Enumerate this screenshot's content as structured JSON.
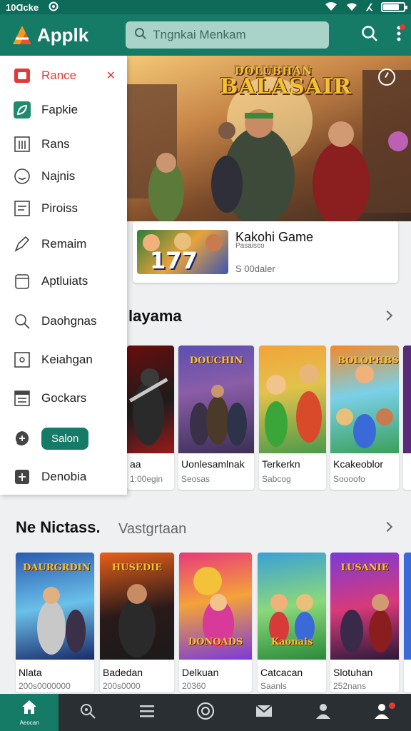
{
  "status_bar": {
    "left_text": "10Ɑcke",
    "battery_level": 0.8
  },
  "app": {
    "name": "Applk",
    "search_placeholder": "Tngnkai Menkam",
    "brand_color": "#157a66"
  },
  "hero": {
    "title_line1": "DOLUBHAN",
    "title_line2": "BALASAIR"
  },
  "featured": {
    "thumb_number": "177",
    "name": "Kakohi Game",
    "subtitle": "Pasaisco",
    "meta": "S 00daler"
  },
  "section1": {
    "title": "layama"
  },
  "row1_cards": [
    {
      "name": "aa",
      "meta": "1:00egin",
      "tag": ""
    },
    {
      "name": "Uonlesamlnak",
      "meta": "Seosas",
      "tag": "DOUCHIN"
    },
    {
      "name": "Terkerkn",
      "meta": "Sabcog",
      "tag": ""
    },
    {
      "name": "Kcakeoblor",
      "meta": "Soooofo",
      "tag": "BOLOPHBS"
    }
  ],
  "section2": {
    "title": "Ne Nictass.",
    "subtitle": "Vastgrtaan"
  },
  "row2_cards": [
    {
      "name": "Nlata",
      "meta": "200s0000000",
      "tag": "DAURGRDIN"
    },
    {
      "name": "Badedan",
      "meta": "200s0000",
      "tag": "HUSEDIE"
    },
    {
      "name": "Delkuan",
      "meta": "20360",
      "tag": "DONOADS"
    },
    {
      "name": "Catcacan",
      "meta": "Saanls",
      "tag": "Kaonais"
    },
    {
      "name": "Slotuhan",
      "meta": "252nans",
      "tag": "LUSANIE"
    }
  ],
  "drawer": {
    "items": [
      {
        "label": "Rance",
        "icon": "record-icon"
      },
      {
        "label": "Fapkie",
        "icon": "leaf-icon"
      },
      {
        "label": "Rans",
        "icon": "grid-icon"
      },
      {
        "label": "Najnis",
        "icon": "smiley-icon"
      },
      {
        "label": "Piroiss",
        "icon": "document-icon"
      },
      {
        "label": "Remaim",
        "icon": "pen-icon"
      },
      {
        "label": "Aptluiats",
        "icon": "cylinder-icon"
      },
      {
        "label": "Daohgnas",
        "icon": "search-icon"
      },
      {
        "label": "Keiahgan",
        "icon": "frame-icon"
      },
      {
        "label": "Gockars",
        "icon": "list-icon"
      },
      {
        "label": "Salon",
        "icon": "plus-bubble-icon"
      },
      {
        "label": "Denobia",
        "icon": "plus-square-icon"
      }
    ]
  },
  "bottom_nav": [
    {
      "label": "Aeocan",
      "icon": "home-icon"
    },
    {
      "label": "",
      "icon": "settings-icon"
    },
    {
      "label": "",
      "icon": "menu-icon"
    },
    {
      "label": "",
      "icon": "target-icon"
    },
    {
      "label": "",
      "icon": "mail-icon"
    },
    {
      "label": "",
      "icon": "person-icon"
    },
    {
      "label": "",
      "icon": "person-badge-icon"
    }
  ]
}
